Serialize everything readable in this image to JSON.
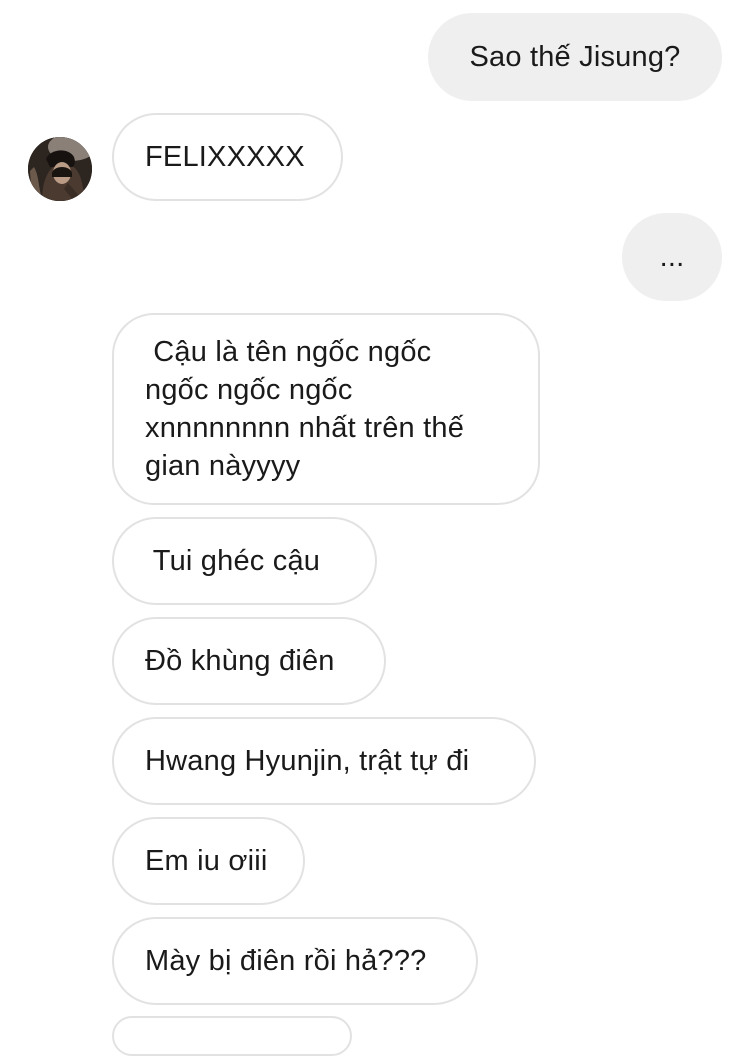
{
  "conversation": {
    "messages": [
      {
        "direction": "outgoing",
        "text": "Sao thế Jisung?"
      },
      {
        "direction": "incoming",
        "text": "FELIXXXXX",
        "has_avatar": true
      },
      {
        "direction": "outgoing",
        "text": "..."
      },
      {
        "direction": "incoming",
        "text": " Cậu là tên ngốc ngốc ngốc ngốc ngốc xnnnnnnnn nhất trên thế gian nàyyyy"
      },
      {
        "direction": "incoming",
        "text": " Tui ghéc cậu"
      },
      {
        "direction": "incoming",
        "text": "Đồ khùng điên"
      },
      {
        "direction": "incoming",
        "text": "Hwang Hyunjin, trật tự đi"
      },
      {
        "direction": "incoming",
        "text": "Em iu ơiii"
      },
      {
        "direction": "incoming",
        "text": "Mày bị điên rồi hả???"
      }
    ]
  },
  "colors": {
    "outgoing_bubble": "#efefef",
    "incoming_border": "#e2e2e2",
    "text": "#1a1a1a",
    "background": "#ffffff"
  }
}
